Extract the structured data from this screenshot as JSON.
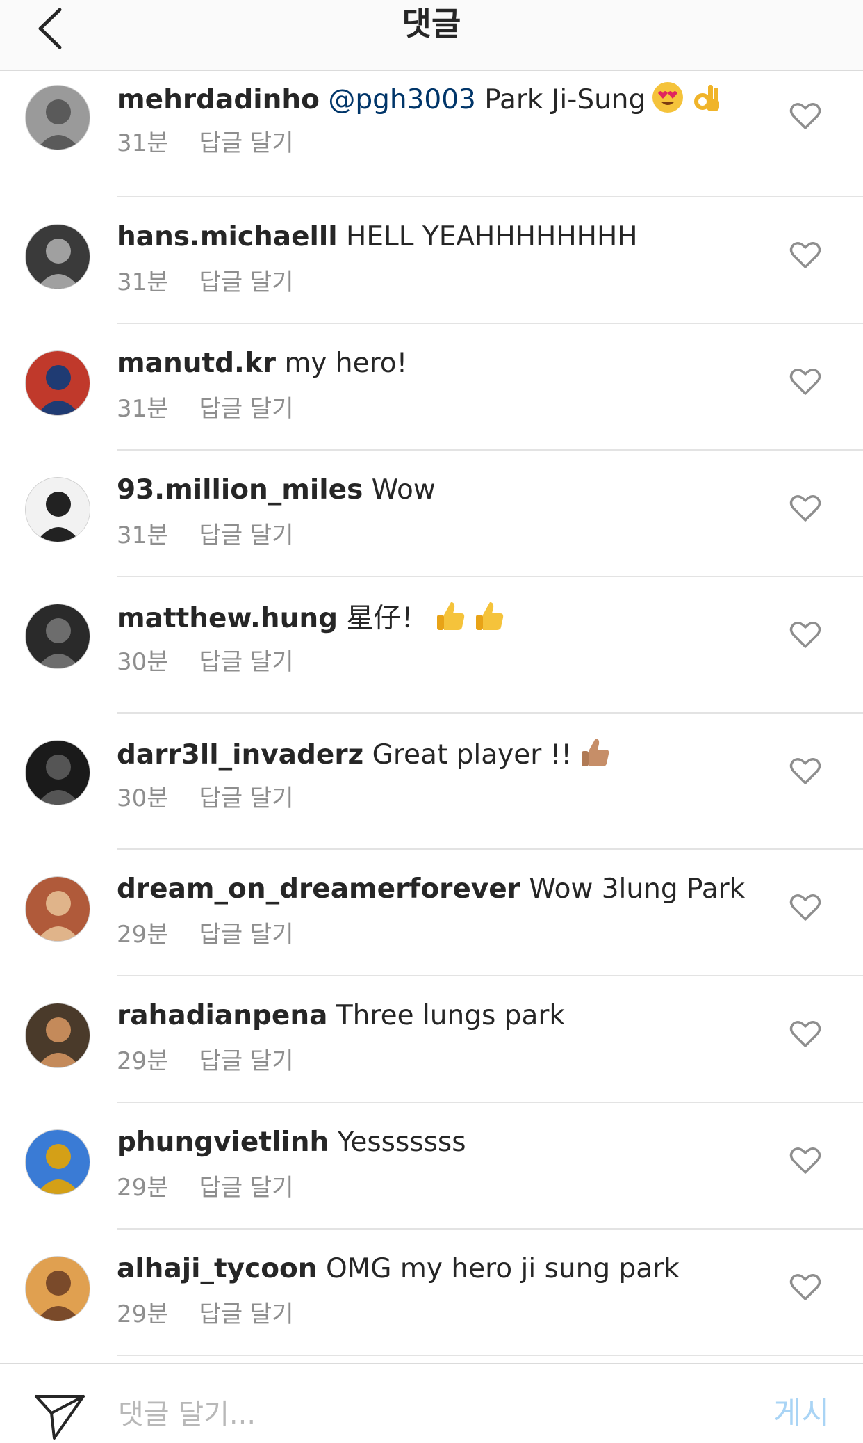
{
  "header": {
    "title": "댓글"
  },
  "comments": [
    {
      "username": "mehrdadinho",
      "mention": "@pgh3003",
      "text": "Park Ji-Sung",
      "emojis": [
        "heart-eyes",
        "ok-hand"
      ],
      "time": "31분",
      "reply": "답글 달기"
    },
    {
      "username": "hans.michaelll",
      "mention": "",
      "text": "HELL YEAHHHHHHHH",
      "emojis": [],
      "time": "31분",
      "reply": "답글 달기"
    },
    {
      "username": "manutd.kr",
      "mention": "",
      "text": "my hero!",
      "emojis": [],
      "time": "31분",
      "reply": "답글 달기"
    },
    {
      "username": "93.million_miles",
      "mention": "",
      "text": "Wow",
      "emojis": [],
      "time": "31분",
      "reply": "답글 달기"
    },
    {
      "username": "matthew.hung",
      "mention": "",
      "text": "星仔！",
      "emojis": [
        "thumbs-up",
        "thumbs-up"
      ],
      "time": "30분",
      "reply": "답글 달기"
    },
    {
      "username": "darr3ll_invaderz",
      "mention": "",
      "text": "Great player !!",
      "emojis": [
        "thumbs-up-medium"
      ],
      "time": "30분",
      "reply": "답글 달기"
    },
    {
      "username": "dream_on_dreamerforever",
      "mention": "",
      "text": "Wow 3lung Park",
      "emojis": [],
      "time": "29분",
      "reply": "답글 달기"
    },
    {
      "username": "rahadianpena",
      "mention": "",
      "text": "Three lungs park",
      "emojis": [],
      "time": "29분",
      "reply": "답글 달기"
    },
    {
      "username": "phungvietlinh",
      "mention": "",
      "text": "Yesssssss",
      "emojis": [],
      "time": "29분",
      "reply": "답글 달기"
    },
    {
      "username": "alhaji_tycoon",
      "mention": "",
      "text": "OMG my hero ji sung park",
      "emojis": [],
      "time": "29분",
      "reply": "답글 달기"
    }
  ],
  "footer": {
    "placeholder": "댓글 달기...",
    "post_label": "게시"
  },
  "colors": {
    "mention": "#003569",
    "meta": "#8e8e8e",
    "post_disabled": "#a9d4f5",
    "divider": "#e3e3e3"
  },
  "icons": {
    "back": "chevron-left-icon",
    "like": "heart-outline-icon",
    "send": "paper-plane-icon"
  }
}
